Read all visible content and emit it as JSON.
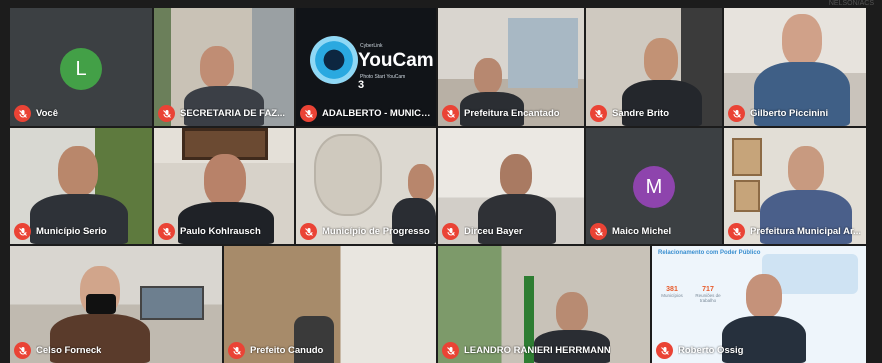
{
  "participants": [
    {
      "name": "Você",
      "avatar_letter": "L",
      "avatar_color": "#43a047"
    },
    {
      "name": "SECRETARIA DE FAZ..."
    },
    {
      "name": "ADALBERTO - MUNICIP...",
      "camera_software": {
        "title": "YouCam",
        "version": "3",
        "brand": "CyberLink",
        "subtitle": "Photo Start YouCam"
      }
    },
    {
      "name": "Prefeitura Encantado"
    },
    {
      "name": "Sandre Brito"
    },
    {
      "name": "Gilberto Piccinini"
    },
    {
      "name": "Município Serio"
    },
    {
      "name": "Paulo Kohlrausch"
    },
    {
      "name": "Município de Progresso"
    },
    {
      "name": "Dirceu Bayer"
    },
    {
      "name": "Maico Michel",
      "avatar_letter": "M",
      "avatar_color": "#8e44ad"
    },
    {
      "name": "Prefeitura Municipal Ar..."
    },
    {
      "name": "Celso Forneck"
    },
    {
      "name": "Prefeito Canudo"
    },
    {
      "name": "LEANDRO RANIERI HERRMANN"
    },
    {
      "name": "Roberto Ossig",
      "presentation": {
        "title": "Relacionamento com Poder Público",
        "stats": [
          {
            "value": "381",
            "label": "Municípios"
          },
          {
            "value": "717",
            "label": "Reuniões de trabalho"
          }
        ]
      }
    }
  ],
  "watermark": "NELSON/ACS",
  "colors": {
    "mic_muted": "#ea4335",
    "grid_background": "#1c1c1c"
  }
}
